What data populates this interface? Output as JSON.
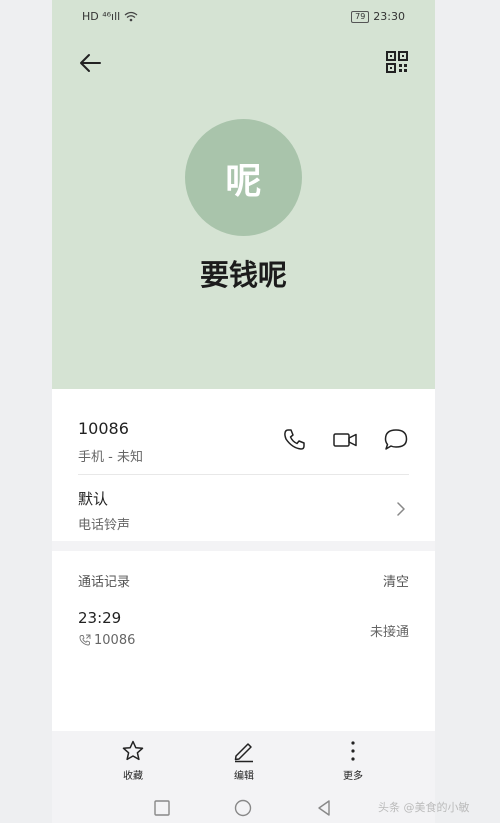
{
  "status_bar": {
    "left": "HD ⁴⁶ıll",
    "battery": "79",
    "time": "23:30"
  },
  "header": {
    "avatar_text": "呢",
    "contact_name": "要钱呢",
    "background_color": "#d5e3d3",
    "avatar_color": "#a9c4ab"
  },
  "contact": {
    "number": "10086",
    "number_type": "手机 - 未知",
    "ringtone_title": "默认",
    "ringtone_label": "电话铃声"
  },
  "call_log": {
    "title": "通话记录",
    "clear_label": "清空",
    "entries": [
      {
        "time": "23:29",
        "number": "10086",
        "status": "未接通"
      }
    ]
  },
  "bottom_tabs": [
    {
      "label": "收藏",
      "icon": "star-icon"
    },
    {
      "label": "编辑",
      "icon": "pencil-icon"
    },
    {
      "label": "更多",
      "icon": "more-vertical-icon"
    }
  ],
  "watermark": "头条 @美食的小敏"
}
